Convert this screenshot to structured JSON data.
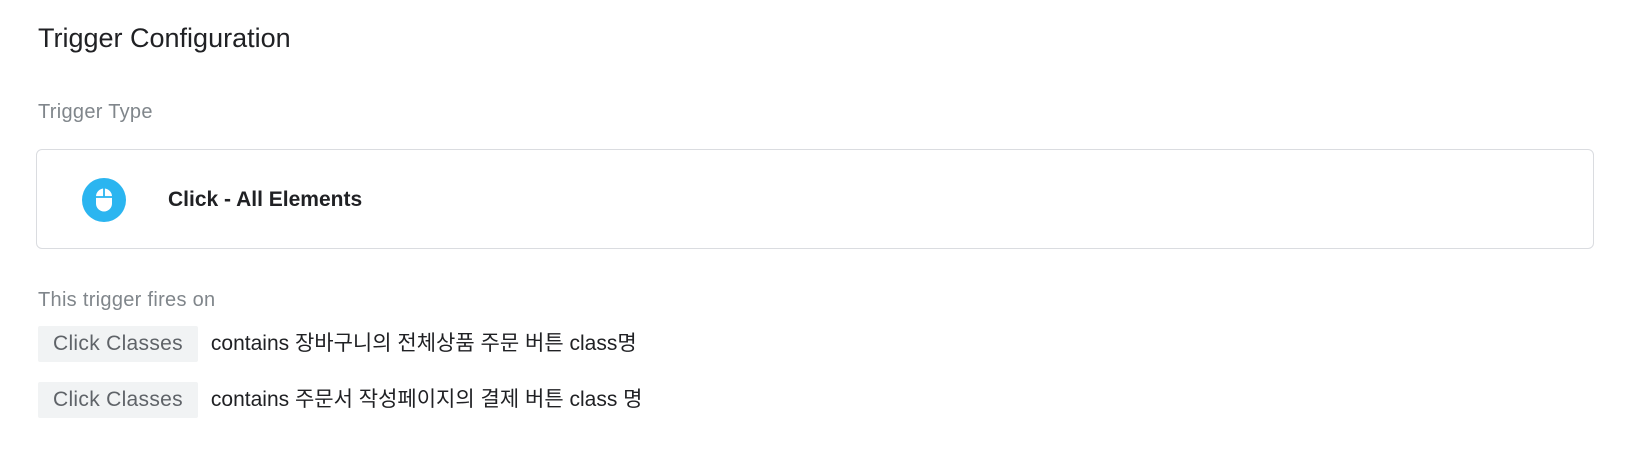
{
  "panel": {
    "title": "Trigger Configuration"
  },
  "trigger_type": {
    "label": "Trigger Type",
    "name": "Click - All Elements",
    "icon": "mouse-icon",
    "icon_color": "#2bb5f0"
  },
  "fires_on": {
    "label": "This trigger fires on",
    "conditions": [
      {
        "variable": "Click Classes",
        "expression": "contains 장바구니의 전체상품 주문 버튼 class명"
      },
      {
        "variable": "Click Classes",
        "expression": "contains 주문서 작성페이지의 결제 버튼 class 명"
      }
    ]
  }
}
